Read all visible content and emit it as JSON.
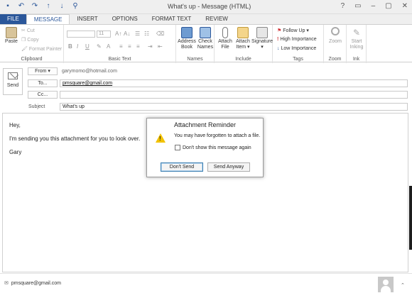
{
  "window": {
    "title": "What's up - Message (HTML)",
    "controls": [
      "?",
      "▭",
      "–",
      "▢",
      "✕"
    ]
  },
  "quick_access": [
    "save-icon",
    "undo-icon",
    "redo-icon",
    "up-icon",
    "down-icon",
    "attach-icon"
  ],
  "tabs": [
    "FILE",
    "MESSAGE",
    "INSERT",
    "OPTIONS",
    "FORMAT TEXT",
    "REVIEW"
  ],
  "ribbon": {
    "clipboard": {
      "label": "Clipboard",
      "paste": "Paste",
      "cut": "Cut",
      "copy": "Copy",
      "format_painter": "Format Painter"
    },
    "basic_text": {
      "label": "Basic Text",
      "font_size": "11",
      "bold": "B",
      "italic": "I",
      "underline": "U"
    },
    "names": {
      "label": "Names",
      "address_book_1": "Address",
      "address_book_2": "Book",
      "check_names_1": "Check",
      "check_names_2": "Names"
    },
    "include": {
      "label": "Include",
      "attach_file_1": "Attach",
      "attach_file_2": "File",
      "attach_item_1": "Attach",
      "attach_item_2": "Item ▾",
      "signature_1": "Signature",
      "signature_2": "▾"
    },
    "tags": {
      "label": "Tags",
      "follow_up": "Follow Up ▾",
      "high_importance": "High Importance",
      "low_importance": "Low Importance"
    },
    "zoom": {
      "label": "Zoom",
      "zoom": "Zoom"
    },
    "ink": {
      "label": "Ink",
      "start_1": "Start",
      "start_2": "Inking"
    }
  },
  "header": {
    "send": "Send",
    "from_label": "From ▾",
    "from_value": "garymomo@hotmail.com",
    "to_label": "To...",
    "to_value": "pmsquare@gmail.com",
    "cc_label": "Cc...",
    "subject_label": "Subject",
    "subject_value": "What's up"
  },
  "body": {
    "line1": "Hey,",
    "line2": "I'm sending you this attachment for you to look over.",
    "line3": "Gary"
  },
  "dialog": {
    "title": "Attachment Reminder",
    "message": "You may have forgotten to attach a file.",
    "checkbox": "Don't show this message again",
    "dont_send": "Don't Send",
    "send_anyway": "Send Anyway"
  },
  "status": {
    "account": "pmsquare@gmail.com"
  },
  "colors": {
    "accent": "#2b579a",
    "warning": "#f2c200"
  }
}
